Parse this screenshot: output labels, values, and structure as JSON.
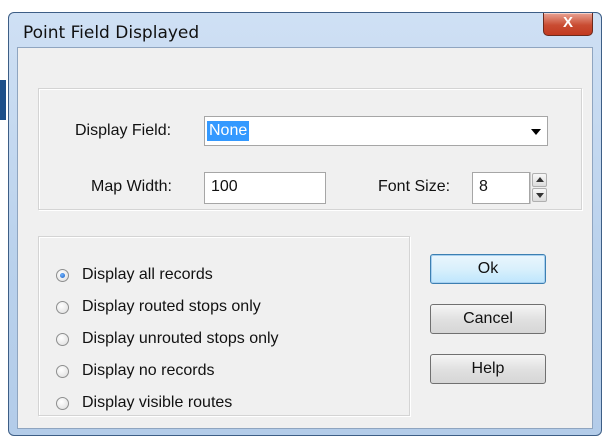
{
  "window": {
    "title": "Point Field Displayed",
    "close_symbol": "X"
  },
  "fields": {
    "display_field_label": "Display Field:",
    "display_field_value": "None",
    "map_width_label": "Map Width:",
    "map_width_value": "100",
    "font_size_label": "Font Size:",
    "font_size_value": "8"
  },
  "radios": [
    {
      "label": "Display all records",
      "checked": true
    },
    {
      "label": "Display routed stops only",
      "checked": false
    },
    {
      "label": "Display unrouted stops only",
      "checked": false
    },
    {
      "label": "Display no records",
      "checked": false
    },
    {
      "label": "Display visible routes",
      "checked": false
    }
  ],
  "buttons": {
    "ok": "Ok",
    "cancel": "Cancel",
    "help": "Help"
  },
  "colors": {
    "selection_highlight": "#3399ff",
    "close_button": "#c94c32",
    "dialog_face": "#f0f0f0"
  }
}
